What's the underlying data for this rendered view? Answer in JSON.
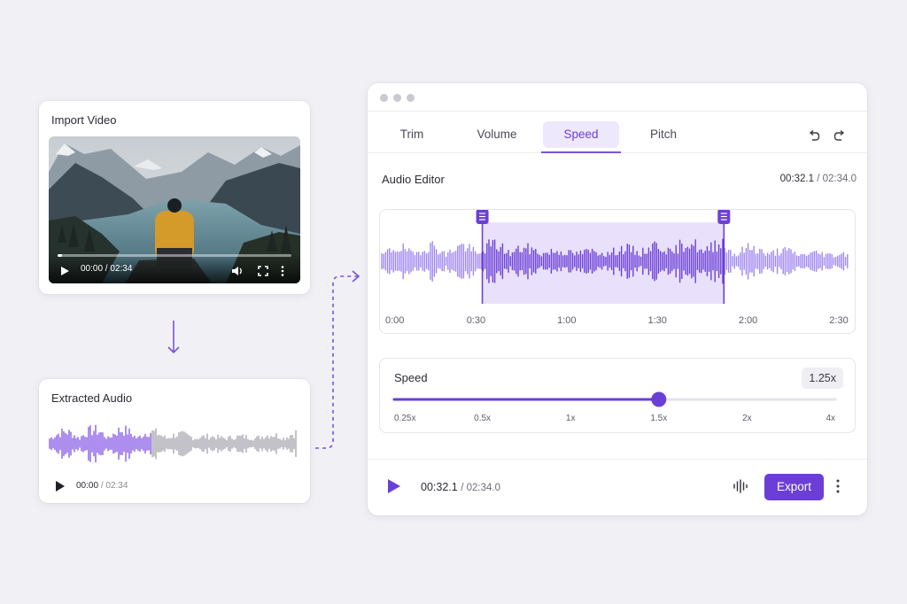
{
  "import_card": {
    "title": "Import Video",
    "video": {
      "time_current": "00:00",
      "time_total": "02:34",
      "time_text": "00:00 / 02:34",
      "progress": 0
    }
  },
  "audio_card": {
    "title": "Extracted Audio",
    "time_current": "00:00",
    "time_total": "/ 02:34"
  },
  "editor": {
    "tabs": [
      "Trim",
      "Volume",
      "Speed",
      "Pitch"
    ],
    "active_tab": "Speed",
    "section_title": "Audio Editor",
    "time_current": "00:32.1",
    "time_total": "/ 02:34.0",
    "timeline_ticks": [
      "0:00",
      "0:30",
      "1:00",
      "1:30",
      "2:00",
      "2:30"
    ],
    "selection_seconds": [
      32.1,
      112.0
    ],
    "total_seconds": 154.0,
    "speed": {
      "label": "Speed",
      "value_label": "1.25x",
      "ticks": [
        "0.25x",
        "0.5x",
        "1x",
        "1.5x",
        "2x",
        "4x"
      ],
      "value_fraction": 0.6
    },
    "footer": {
      "time_current": "00:32.1",
      "time_total": "/ 02:34.0",
      "export_label": "Export"
    }
  },
  "colors": {
    "accent": "#6b3fd6",
    "accent_light": "#9f86ef",
    "selection_bg": "#e9e1fc",
    "wave_gray": "#a9a9b1"
  },
  "icons": [
    "play-icon",
    "volume-icon",
    "fullscreen-icon",
    "more-vertical-icon",
    "undo-icon",
    "redo-icon",
    "waveform-icon",
    "handle-icon",
    "arrow-down-icon",
    "arrow-right-icon"
  ]
}
